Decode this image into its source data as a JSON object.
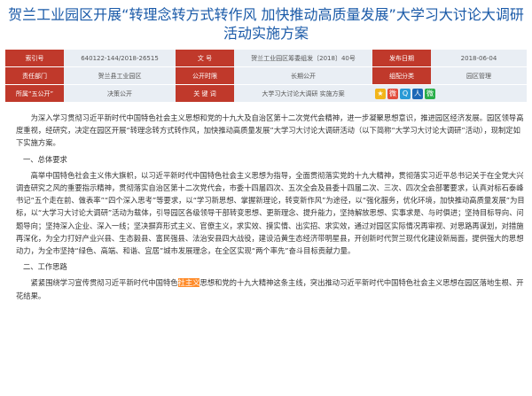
{
  "title": "贺兰工业园区开展“转理念转方式转作风 加快推动高质量发展”大学习大讨论大调研活动实施方案",
  "meta": {
    "row1": {
      "l1": "索引号",
      "v1": "640122-144/2018-26515",
      "l2": "文 号",
      "v2": "贺兰工业园区筹委组发〔2018〕40号",
      "l3": "发布日期",
      "v3": "2018-06-04"
    },
    "row2": {
      "l1": "责任部门",
      "v1": "贺兰县工业园区",
      "l2": "公开时限",
      "v2": "长期公开",
      "l3": "组配分类",
      "v3": "园区管理"
    },
    "row3": {
      "l1": "所属“五公开”",
      "v1": "决策公开",
      "l2": "关 键 词",
      "v2": "大学习大讨论大调研 实施方案",
      "l3": ""
    }
  },
  "share_icons": [
    "qzone-icon",
    "tsina-icon",
    "tqq-icon",
    "renren-icon",
    "weixin-icon"
  ],
  "body": {
    "p1": "为深入学习贯彻习近平新时代中国特色社会主义思想和党的十九大及自治区第十二次党代会精神，进一步凝聚思想意识，推进园区经济发展。园区领导高度重视，经研究，决定在园区开展“转理念转方式转作风，加快推动高质量发展”大学习大讨论大调研活动（以下简称“大学习大讨论大调研”活动），现制定如下实施方案。",
    "h1": "一、总体要求",
    "p2": "高举中国特色社会主义伟大旗帜，以习近平新时代中国特色社会主义思想为指导，全面贯彻落实党的十九大精神，贯彻落实习近平总书记关于在全党大兴调查研究之风的重要指示精神，贯彻落实自治区第十二次党代会，市委十四届四次、五次全会及县委十四届二次、三次、四次全会部署要求，认真对标石泰峰书记“五个走在前、做表率”“四个深入思考”等要求，以“学习新思想、掌握新理论，转变新作风”为途径，以“强化服务，优化环境，加快推动高质量发展”为目标，以“大学习大讨论大调研”活动为载体，引导园区各级领导干部转变思想、更新理念、提升能力，坚持解放思想、实事求是、与时俱进；坚持目标导向、问题导向；坚持深入企业、深入一线；坚决摒弃形式主义、官僚主义，求实效、摸实情、出实招、求实效，通过对园区实际情况再审视、对思路再谋划，对措施再深化，为全力打好产业兴县、生态毅县、富民强县、法治安县四大战役，建设沿黄生态经济带明星县，开创新时代贺兰现代化建设新局面，提供强大的思想动力，为全市坚持“绿色、高端、和谐、宜居”城市发展理念，在全区实现“两个率先”奋斗目标贡献力量。",
    "h2": "二、工作思路",
    "p3a": "紧紧围绕学习宣传贯彻习近平新时代中国特色",
    "p3hl": "社主义",
    "p3b": "思想和党的十九大精神这条主线，突出推动习近平新时代中国特色社会主义思想在园区落地生根、开花结果。"
  }
}
